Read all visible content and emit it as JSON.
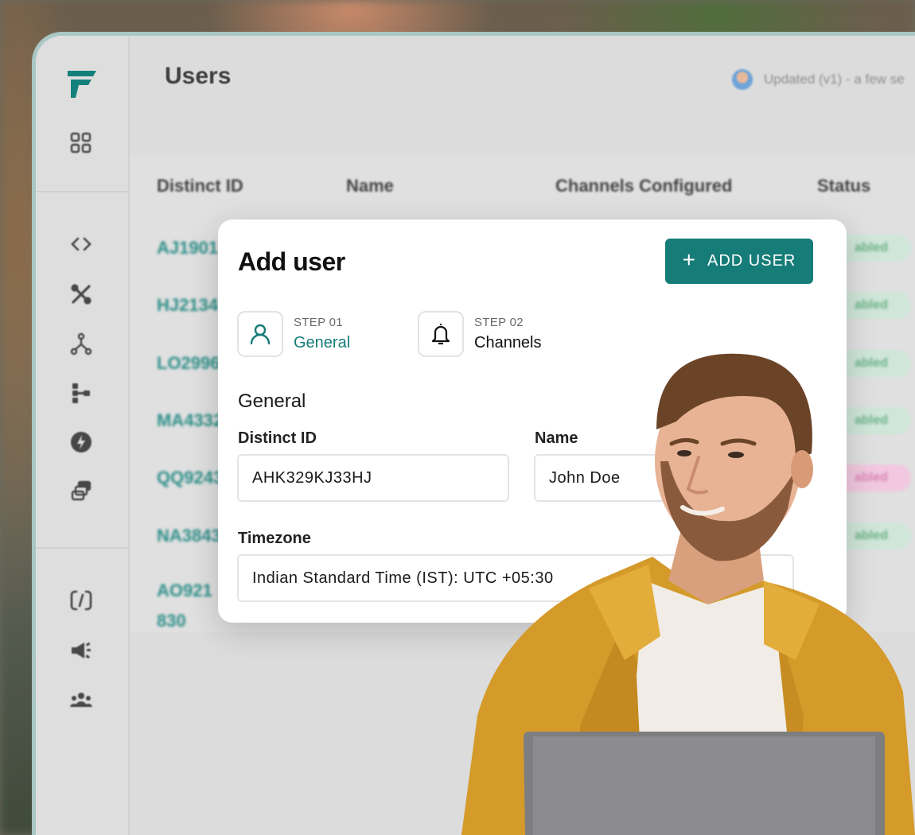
{
  "app": {
    "title": "Users",
    "updated_text": "Updated (v1) - a few se"
  },
  "sidebar": {
    "logo": "F",
    "icons": [
      "dashboard-icon",
      "code-icon",
      "tools-icon",
      "workflow-icon",
      "tree-icon",
      "bolt-icon",
      "layers-icon",
      "loop-icon",
      "megaphone-icon",
      "users-icon"
    ]
  },
  "table": {
    "headers": [
      "Distinct ID",
      "Name",
      "Channels Configured",
      "Status"
    ],
    "rows": [
      {
        "id": "AJ1901",
        "status": "abled"
      },
      {
        "id": "HJ2134",
        "status": "abled"
      },
      {
        "id": "LO2996",
        "status": "abled"
      },
      {
        "id": "MA4332",
        "status": "abled"
      },
      {
        "id": "QQ9243",
        "status": "abled"
      },
      {
        "id": "NA3843",
        "status": "abled"
      },
      {
        "id": "AO921",
        "id_line2": "830",
        "status": ""
      }
    ]
  },
  "modal": {
    "title": "Add user",
    "add_button": "ADD USER",
    "steps": [
      {
        "number": "STEP 01",
        "name": "General"
      },
      {
        "number": "STEP 02",
        "name": "Channels"
      }
    ],
    "section": "General",
    "fields": {
      "distinct_id": {
        "label": "Distinct ID",
        "value": "AHK329KJ33HJ"
      },
      "name": {
        "label": "Name",
        "value": "John Doe"
      },
      "timezone": {
        "label": "Timezone",
        "value": "Indian Standard Time (IST): UTC +05:30"
      }
    }
  },
  "colors": {
    "brand": "#167c78",
    "enabled_pill": "#cfe6d8",
    "disabled_pill": "#f1c8df"
  }
}
